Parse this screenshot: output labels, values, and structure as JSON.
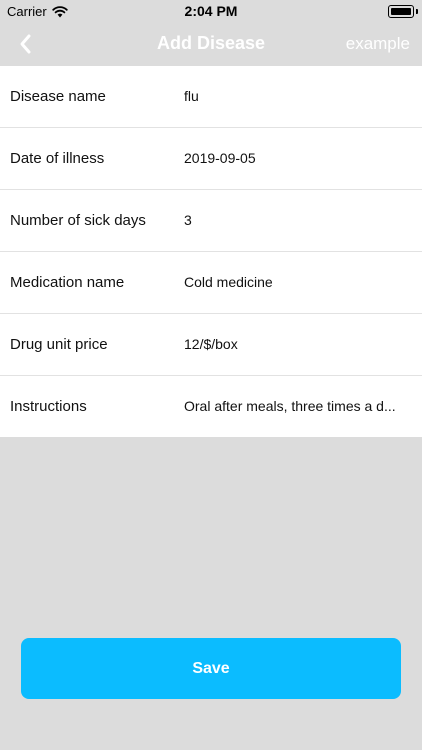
{
  "status_bar": {
    "carrier": "Carrier",
    "time": "2:04 PM",
    "wifi_icon": "wifi-icon",
    "battery_icon": "battery-icon"
  },
  "nav": {
    "back_icon": "chevron-left-icon",
    "title": "Add Disease",
    "right_label": "example"
  },
  "form": {
    "rows": [
      {
        "label": "Disease name",
        "value": "flu"
      },
      {
        "label": "Date of illness",
        "value": "2019-09-05"
      },
      {
        "label": "Number of sick days",
        "value": "3"
      },
      {
        "label": "Medication name",
        "value": "Cold medicine"
      },
      {
        "label": "Drug unit price",
        "value": "12/$/box"
      },
      {
        "label": "Instructions",
        "value": "Oral after meals, three times a d..."
      }
    ]
  },
  "actions": {
    "save_label": "Save"
  },
  "colors": {
    "background": "#dcdcdc",
    "accent": "#0bbcff",
    "form_background": "#ffffff"
  }
}
